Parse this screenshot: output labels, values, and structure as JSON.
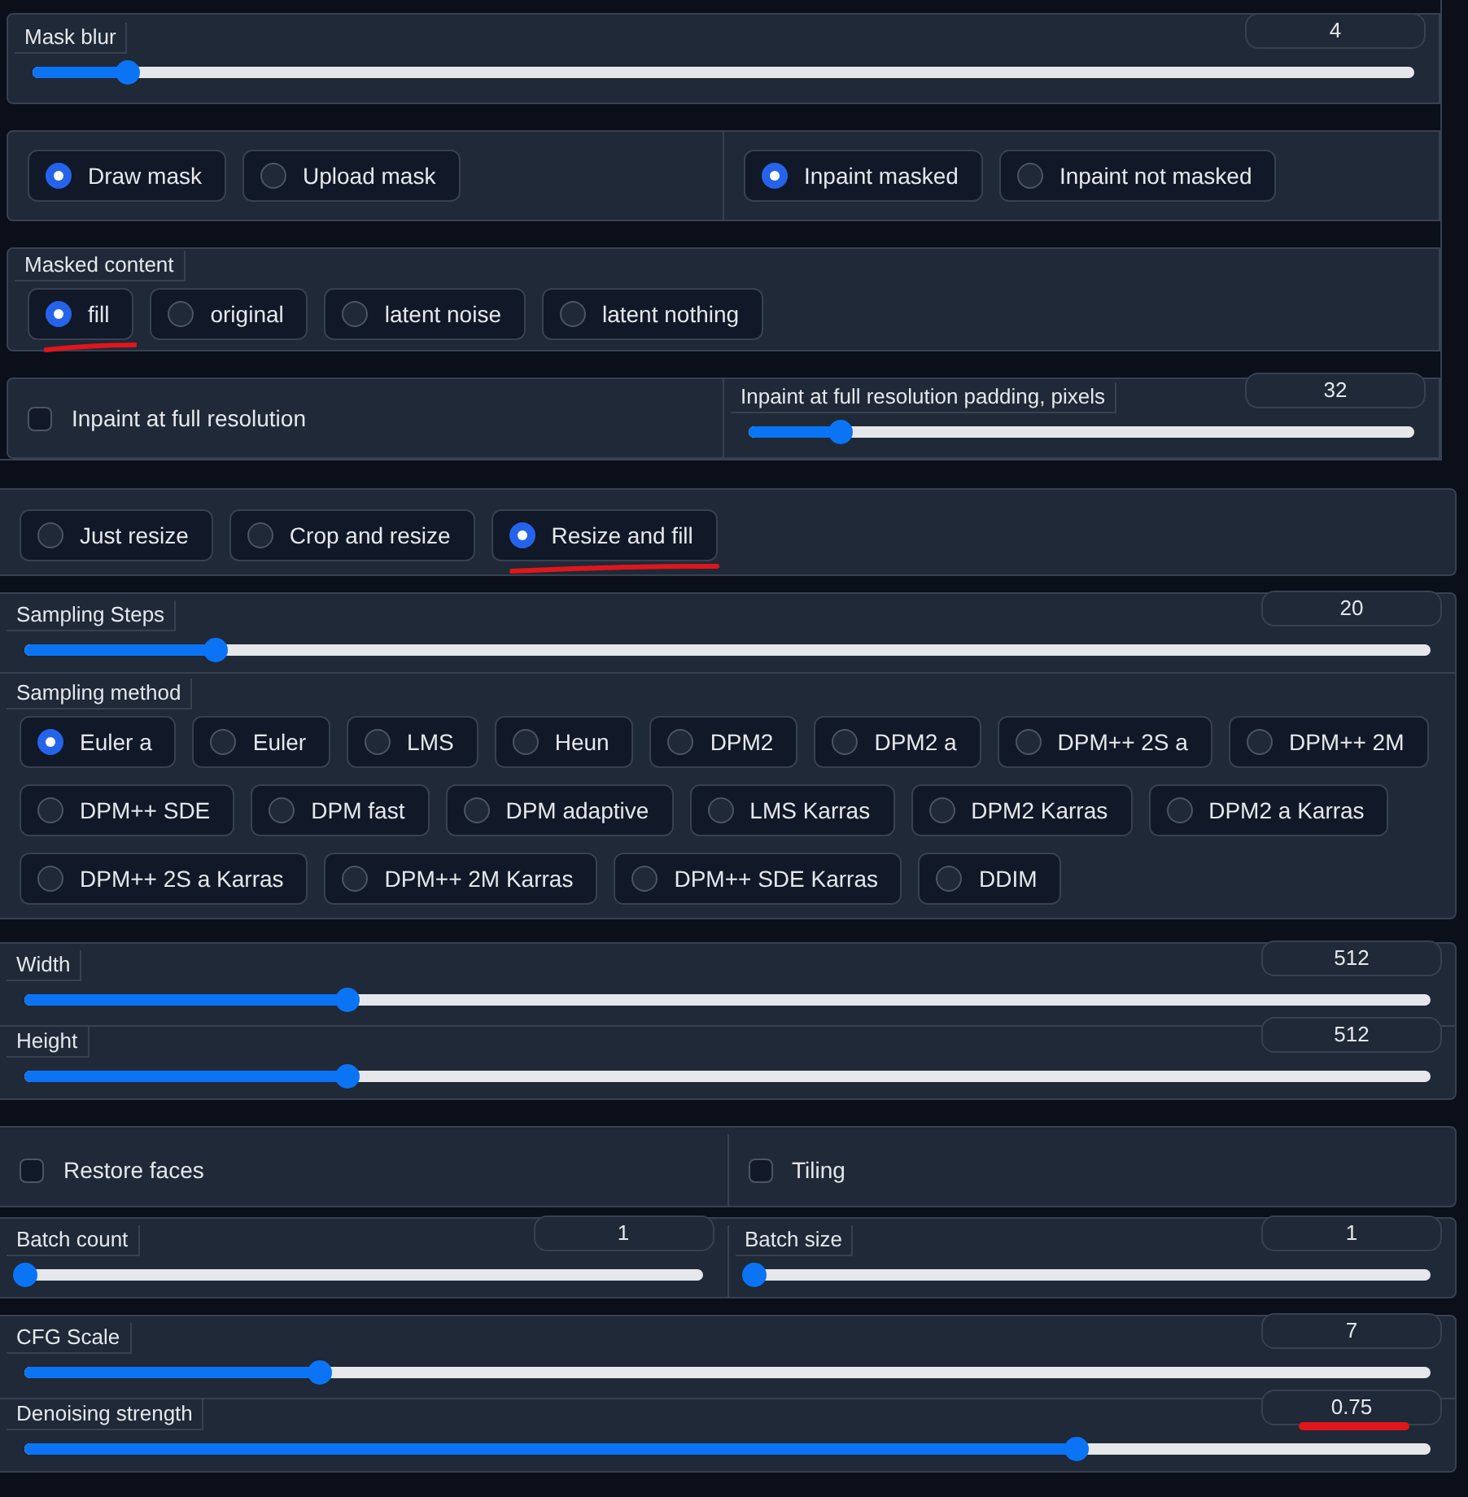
{
  "top_frame": {
    "panels": [
      {
        "columns": [
          [
            {
              "kind": "slider",
              "label": "Mask blur",
              "value": "4",
              "level": 0.068,
              "underlined": false
            }
          ]
        ]
      },
      {
        "columns": [
          [
            {
              "kind": "radios",
              "options": [
                {
                  "label": "Draw mask",
                  "selected": true,
                  "underlined": false
                },
                {
                  "label": "Upload mask",
                  "selected": false,
                  "underlined": false
                }
              ]
            }
          ],
          [
            {
              "kind": "radios",
              "options": [
                {
                  "label": "Inpaint masked",
                  "selected": true,
                  "underlined": false
                },
                {
                  "label": "Inpaint not masked",
                  "selected": false,
                  "underlined": false
                }
              ]
            }
          ]
        ]
      },
      {
        "columns": [
          [
            {
              "kind": "radios",
              "label": "Masked content",
              "options": [
                {
                  "label": "fill",
                  "selected": true,
                  "underlined": true
                },
                {
                  "label": "original",
                  "selected": false,
                  "underlined": false
                },
                {
                  "label": "latent noise",
                  "selected": false,
                  "underlined": false
                },
                {
                  "label": "latent nothing",
                  "selected": false,
                  "underlined": false
                }
              ]
            }
          ]
        ]
      },
      {
        "columns": [
          [
            {
              "kind": "checkbox",
              "label": "Inpaint at full resolution",
              "checked": false
            }
          ],
          [
            {
              "kind": "slider",
              "label": "Inpaint at full resolution padding, pixels",
              "value": "32",
              "level": 0.136,
              "underlined": false
            }
          ]
        ]
      }
    ]
  },
  "panels": [
    {
      "columns": [
        [
          {
            "kind": "radios",
            "options": [
              {
                "label": "Just resize",
                "selected": false,
                "underlined": false
              },
              {
                "label": "Crop and resize",
                "selected": false,
                "underlined": false
              },
              {
                "label": "Resize and fill",
                "selected": true,
                "underlined": true
              }
            ]
          }
        ]
      ]
    },
    {
      "columns": [
        [
          {
            "kind": "slider",
            "label": "Sampling Steps",
            "value": "20",
            "level": 0.135,
            "underlined": false
          },
          {
            "kind": "radios",
            "label": "Sampling method",
            "options": [
              {
                "label": "Euler a",
                "selected": true,
                "underlined": false
              },
              {
                "label": "Euler",
                "selected": false,
                "underlined": false
              },
              {
                "label": "LMS",
                "selected": false,
                "underlined": false
              },
              {
                "label": "Heun",
                "selected": false,
                "underlined": false
              },
              {
                "label": "DPM2",
                "selected": false,
                "underlined": false
              },
              {
                "label": "DPM2 a",
                "selected": false,
                "underlined": false
              },
              {
                "label": "DPM++ 2S a",
                "selected": false,
                "underlined": false
              },
              {
                "label": "DPM++ 2M",
                "selected": false,
                "underlined": false
              },
              {
                "label": "DPM++ SDE",
                "selected": false,
                "underlined": false
              },
              {
                "label": "DPM fast",
                "selected": false,
                "underlined": false
              },
              {
                "label": "DPM adaptive",
                "selected": false,
                "underlined": false
              },
              {
                "label": "LMS Karras",
                "selected": false,
                "underlined": false
              },
              {
                "label": "DPM2 Karras",
                "selected": false,
                "underlined": false
              },
              {
                "label": "DPM2 a Karras",
                "selected": false,
                "underlined": false
              },
              {
                "label": "DPM++ 2S a Karras",
                "selected": false,
                "underlined": false
              },
              {
                "label": "DPM++ 2M Karras",
                "selected": false,
                "underlined": false
              },
              {
                "label": "DPM++ SDE Karras",
                "selected": false,
                "underlined": false
              },
              {
                "label": "DDIM",
                "selected": false,
                "underlined": false
              }
            ]
          }
        ]
      ]
    },
    {
      "columns": [
        [
          {
            "kind": "slider",
            "label": "Width",
            "value": "512",
            "level": 0.229,
            "underlined": false
          },
          {
            "kind": "slider",
            "label": "Height",
            "value": "512",
            "level": 0.229,
            "underlined": false
          }
        ]
      ]
    },
    {
      "columns": [
        [
          {
            "kind": "checkbox",
            "label": "Restore faces",
            "checked": false
          }
        ],
        [
          {
            "kind": "checkbox",
            "label": "Tiling",
            "checked": false
          }
        ]
      ]
    },
    {
      "columns": [
        [
          {
            "kind": "slider",
            "label": "Batch count",
            "value": "1",
            "level": 0,
            "underlined": false
          }
        ],
        [
          {
            "kind": "slider",
            "label": "Batch size",
            "value": "1",
            "level": 0,
            "underlined": false
          }
        ]
      ]
    },
    {
      "columns": [
        [
          {
            "kind": "slider",
            "label": "CFG Scale",
            "value": "7",
            "level": 0.21,
            "underlined": false
          },
          {
            "kind": "slider",
            "label": "Denoising strength",
            "value": "0.75",
            "level": 0.748,
            "underlined": true
          }
        ]
      ]
    }
  ]
}
